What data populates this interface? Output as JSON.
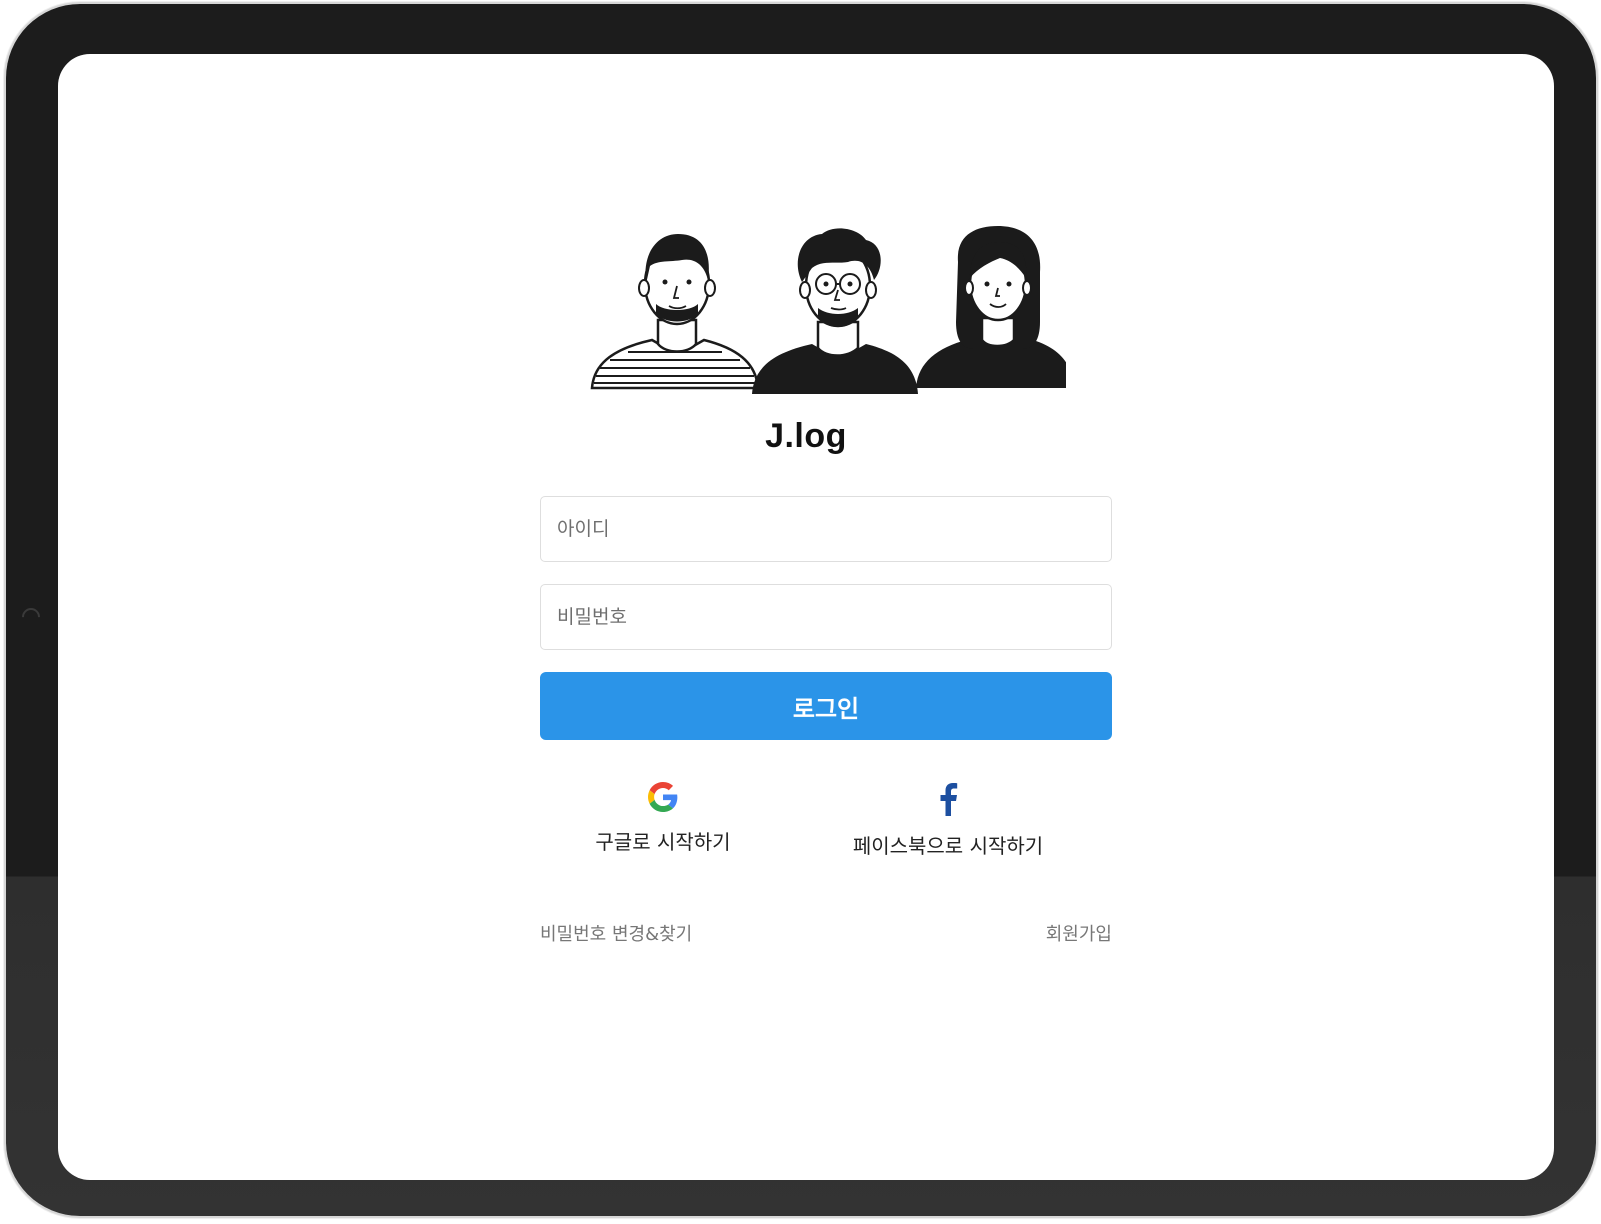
{
  "app": {
    "brand": "J.log"
  },
  "login_form": {
    "id_placeholder": "아이디",
    "password_placeholder": "비밀번호",
    "login_label": "로그인"
  },
  "social": {
    "google_label": "구글로 시작하기",
    "google_icon": "google-icon",
    "facebook_label": "페이스북으로 시작하기",
    "facebook_icon": "facebook-icon"
  },
  "footer": {
    "password_link": "비밀번호 변경&찾기",
    "signup_link": "회원가입"
  },
  "colors": {
    "primary": "#2b94e8",
    "facebook": "#1d4fa0"
  }
}
